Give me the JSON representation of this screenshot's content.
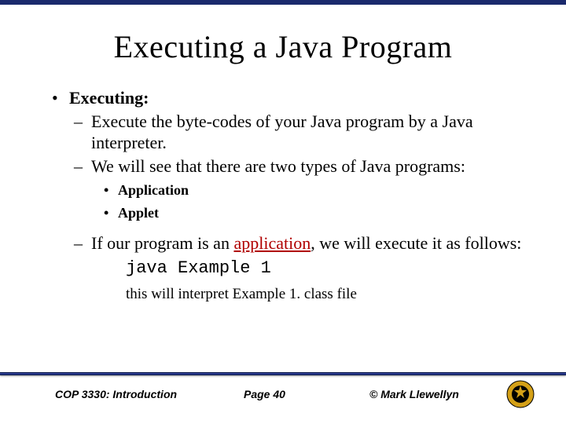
{
  "title": "Executing a Java Program",
  "bullets": {
    "l1_label": "Executing:",
    "l2_1": "Execute the byte-codes of your Java program by a Java interpreter.",
    "l2_2": "We will see that there are two types of Java programs:",
    "l3_1": "Application",
    "l3_2": "Applet",
    "l2_3a": "If our program is an ",
    "l2_3_app": "application",
    "l2_3b": ", we will execute it as follows:",
    "cmd": "java Example 1",
    "note": "this will interpret Example 1. class file"
  },
  "footer": {
    "left": "COP 3330: Introduction",
    "center": "Page 40",
    "right": "© Mark Llewellyn"
  }
}
